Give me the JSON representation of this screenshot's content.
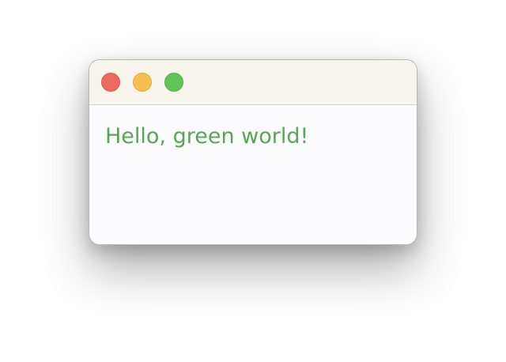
{
  "window": {
    "controls": [
      {
        "name": "close-button",
        "icon": "circle",
        "color": "#ee6a5f"
      },
      {
        "name": "minimize-button",
        "icon": "circle",
        "color": "#f5be4f"
      },
      {
        "name": "maximize-button",
        "icon": "circle",
        "color": "#61c554"
      }
    ]
  },
  "content": {
    "message": "Hello, green world!",
    "message_color": "#5aa457"
  }
}
